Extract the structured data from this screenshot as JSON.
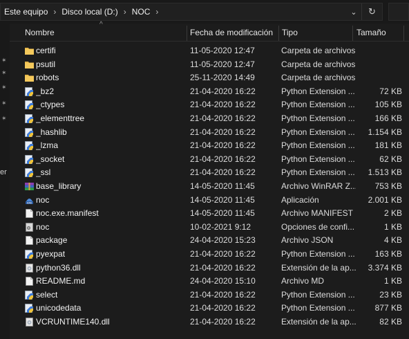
{
  "breadcrumb": [
    "Este equipo",
    "Disco local (D:)",
    "NOC"
  ],
  "gutter_text": "er",
  "columns": {
    "name": "Nombre",
    "date": "Fecha de modificación",
    "type": "Tipo",
    "size": "Tamaño"
  },
  "files": [
    {
      "name": "certifi",
      "date": "11-05-2020 12:47",
      "type": "Carpeta de archivos",
      "size": "",
      "icon": "folder-icon"
    },
    {
      "name": "psutil",
      "date": "11-05-2020 12:47",
      "type": "Carpeta de archivos",
      "size": "",
      "icon": "folder-icon"
    },
    {
      "name": "robots",
      "date": "25-11-2020 14:49",
      "type": "Carpeta de archivos",
      "size": "",
      "icon": "folder-icon"
    },
    {
      "name": "_bz2",
      "date": "21-04-2020 16:22",
      "type": "Python Extension ...",
      "size": "72 KB",
      "icon": "python-extension-icon"
    },
    {
      "name": "_ctypes",
      "date": "21-04-2020 16:22",
      "type": "Python Extension ...",
      "size": "105 KB",
      "icon": "python-extension-icon"
    },
    {
      "name": "_elementtree",
      "date": "21-04-2020 16:22",
      "type": "Python Extension ...",
      "size": "166 KB",
      "icon": "python-extension-icon"
    },
    {
      "name": "_hashlib",
      "date": "21-04-2020 16:22",
      "type": "Python Extension ...",
      "size": "1.154 KB",
      "icon": "python-extension-icon"
    },
    {
      "name": "_lzma",
      "date": "21-04-2020 16:22",
      "type": "Python Extension ...",
      "size": "181 KB",
      "icon": "python-extension-icon"
    },
    {
      "name": "_socket",
      "date": "21-04-2020 16:22",
      "type": "Python Extension ...",
      "size": "62 KB",
      "icon": "python-extension-icon"
    },
    {
      "name": "_ssl",
      "date": "21-04-2020 16:22",
      "type": "Python Extension ...",
      "size": "1.513 KB",
      "icon": "python-extension-icon"
    },
    {
      "name": "base_library",
      "date": "14-05-2020 11:45",
      "type": "Archivo WinRAR Z...",
      "size": "753 KB",
      "icon": "winrar-archive-icon"
    },
    {
      "name": "noc",
      "date": "14-05-2020 11:45",
      "type": "Aplicación",
      "size": "2.001 KB",
      "icon": "application-icon"
    },
    {
      "name": "noc.exe.manifest",
      "date": "14-05-2020 11:45",
      "type": "Archivo MANIFEST",
      "size": "2 KB",
      "icon": "file-icon"
    },
    {
      "name": "noc",
      "date": "10-02-2021 9:12",
      "type": "Opciones de confi...",
      "size": "1 KB",
      "icon": "config-file-icon"
    },
    {
      "name": "package",
      "date": "24-04-2020 15:23",
      "type": "Archivo JSON",
      "size": "4 KB",
      "icon": "file-icon"
    },
    {
      "name": "pyexpat",
      "date": "21-04-2020 16:22",
      "type": "Python Extension ...",
      "size": "163 KB",
      "icon": "python-extension-icon"
    },
    {
      "name": "python36.dll",
      "date": "21-04-2020 16:22",
      "type": "Extensión de la ap...",
      "size": "3.374 KB",
      "icon": "dll-icon"
    },
    {
      "name": "README.md",
      "date": "24-04-2020 15:10",
      "type": "Archivo MD",
      "size": "1 KB",
      "icon": "file-icon"
    },
    {
      "name": "select",
      "date": "21-04-2020 16:22",
      "type": "Python Extension ...",
      "size": "23 KB",
      "icon": "python-extension-icon"
    },
    {
      "name": "unicodedata",
      "date": "21-04-2020 16:22",
      "type": "Python Extension ...",
      "size": "877 KB",
      "icon": "python-extension-icon"
    },
    {
      "name": "VCRUNTIME140.dll",
      "date": "21-04-2020 16:22",
      "type": "Extensión de la ap...",
      "size": "82 KB",
      "icon": "dll-icon"
    }
  ]
}
